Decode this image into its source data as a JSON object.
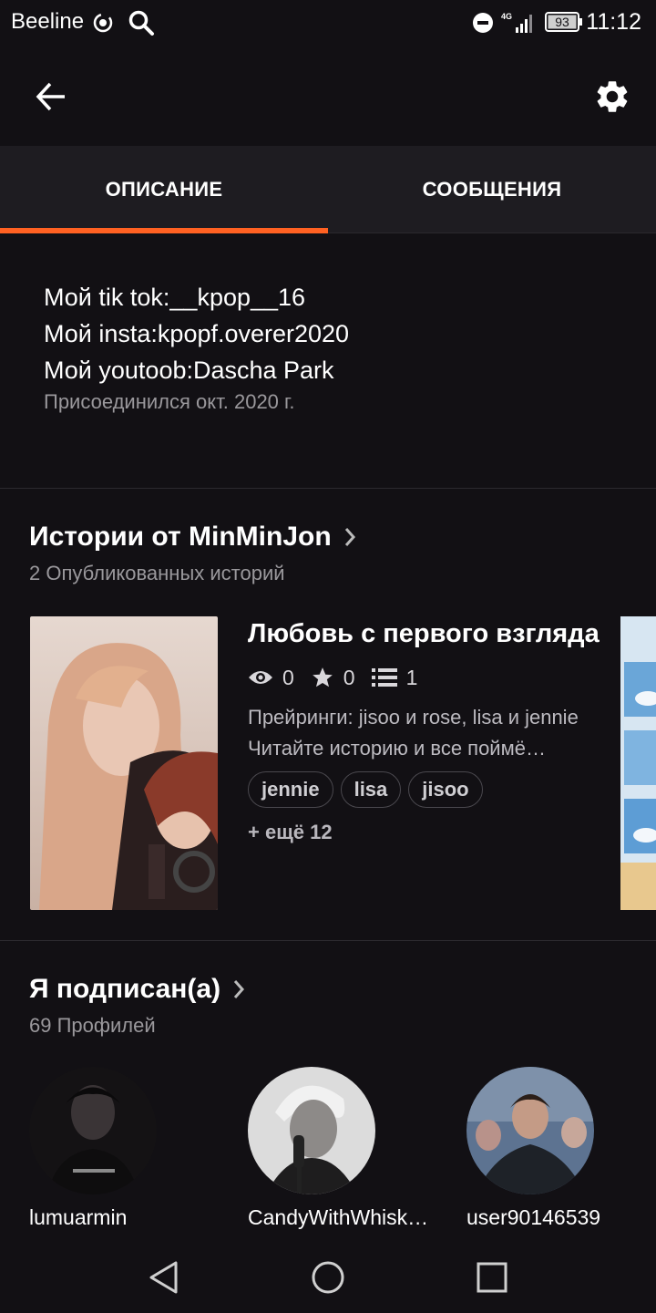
{
  "status_bar": {
    "carrier": "Beeline",
    "signal_type": "4G",
    "battery": "93",
    "time": "11:12"
  },
  "appbar": {
    "back_icon": "arrow-back-icon",
    "settings_icon": "gear-icon"
  },
  "tabs": [
    {
      "label": "ОПИСАНИЕ",
      "active": true
    },
    {
      "label": "СООБЩЕНИЯ",
      "active": false
    }
  ],
  "accent_color": "#ff6122",
  "description": {
    "lines": [
      "Мой tik tok:__kpop__16",
      "Мой insta:kpopf.overer2020",
      "Мой youtoob:Dascha Park"
    ],
    "joined": "Присоединился окт. 2020 г."
  },
  "stories_section": {
    "title": "Истории от MinMinJon",
    "subtitle": "2 Опубликованных историй",
    "story": {
      "title": "Любовь с первого взгляда",
      "views": "0",
      "votes": "0",
      "parts": "1",
      "desc_line1": "Прейринги: jisoo и rose, lisa и jennie",
      "desc_line2": "Читайте историю и все поймё…",
      "tags": [
        "jennie",
        "lisa",
        "jisoo"
      ],
      "more_tags": "+ ещё 12"
    }
  },
  "following_section": {
    "title": "Я подписан(а)",
    "subtitle": "69 Профилей",
    "profiles": [
      {
        "name": "lumuarmin"
      },
      {
        "name": "CandyWithWhisk…"
      },
      {
        "name": "user90146539"
      }
    ]
  },
  "navbar": {
    "back": "triangle-back-icon",
    "home": "circle-home-icon",
    "recents": "square-recents-icon"
  }
}
